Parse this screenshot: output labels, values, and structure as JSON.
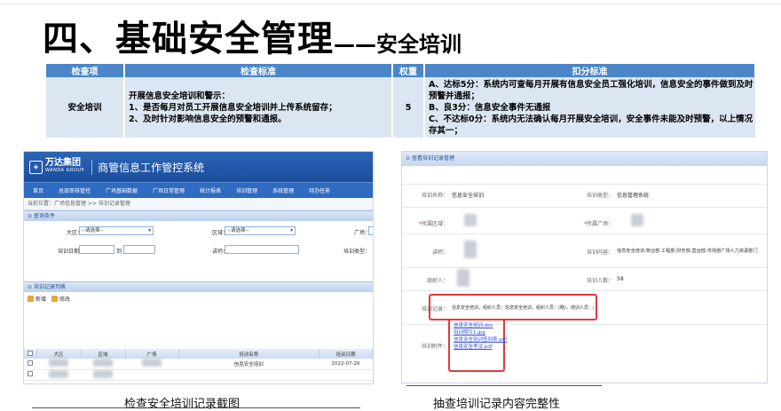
{
  "slide": {
    "title_main": "四、基础安全管理",
    "title_dash": "——",
    "title_sub": "安全培训"
  },
  "criteria_table": {
    "headers": [
      "检查项",
      "检查标准",
      "权重",
      "扣分标准"
    ],
    "item": "安全培训",
    "standard_lines": [
      "开展信息安全培训和警示：",
      "1、是否每月对员工开展信息安全培训并上传系统留存；",
      "2、及时针对影响信息安全的预警和通报。"
    ],
    "weight": "5",
    "scoring_lines": [
      "A、达标5分：系统内可查每月开展有信息安全员工强化培训，信息安全的事件做到及时预警并通报；",
      "B、良3分：信息安全事件无通报",
      "C、不达标0分：系统内无法确认每月开展安全培训，安全事件未能及时预警，以上情况存其一；"
    ]
  },
  "left_screenshot": {
    "logo_cn": "万达集团",
    "logo_en": "WANDA GROUP",
    "system_name": "商管信息工作管控系统",
    "nav": [
      "首页",
      "总部审核管控",
      "广场基础数据",
      "广场日常管理",
      "统计报表",
      "培训管理",
      "系统管理",
      "待办任务"
    ],
    "breadcrumb": "当前位置：广场信息管理 >> 培训记录管理",
    "search_section": "查询条件",
    "form": {
      "region_label": "大区：",
      "region_value": "--请选择--",
      "area_label": "区域：",
      "area_value": "--请选择--",
      "plaza_label": "广场：",
      "date_label": "培训日期：",
      "date_to": "到",
      "lecturer_label": "讲师：",
      "type_label": "培训类型："
    },
    "list_section": "培训记录列表",
    "toolbar": [
      "新增",
      "修改"
    ],
    "grid_headers": [
      "",
      "大区",
      "区域",
      "广场",
      "培训名称",
      "培训日期"
    ],
    "grid_rows": [
      {
        "name": "信息安全培训",
        "date": "2022-07-26"
      }
    ]
  },
  "right_screenshot": {
    "panel_title": "查看培训记录管理",
    "fields": {
      "training_name_label": "培训名称：",
      "training_name_value": "信息安全培训",
      "training_type_label": "培训类型：",
      "training_type_value": "信息管理系统",
      "region_label": "所属区域：",
      "plaza_label": "所属广场：",
      "lecturer_label": "讲师：",
      "content_label": "培训内容：",
      "content_value": "信息安全培训,物业部,工程部,财务部,营运部,市场部广场人力资源部门",
      "organizer_label": "组织人：",
      "attendance_label": "培训人数：",
      "attendance_value": "58",
      "record_label": "培训记录：",
      "record_value": "信息安全培训，组织人员：信息安全培训，组织人员：(略)，培训人员：广场各部门人员，培训方式：线下培训",
      "attachment_label": "培训附件："
    },
    "attachments": [
      "信息安全培训.doc",
      "培训照片1.jpg",
      "信息安全培训签到表.pdf",
      "信息安全考试.pdf"
    ]
  },
  "captions": {
    "left": "检查安全培训记录截图",
    "right": "抽查培训记录内容完整性"
  },
  "colors": {
    "header_blue": "#4a86c8",
    "row_fill": "#dce6f2",
    "system_blue": "#2c64b7",
    "highlight_red": "#e23a3a"
  }
}
